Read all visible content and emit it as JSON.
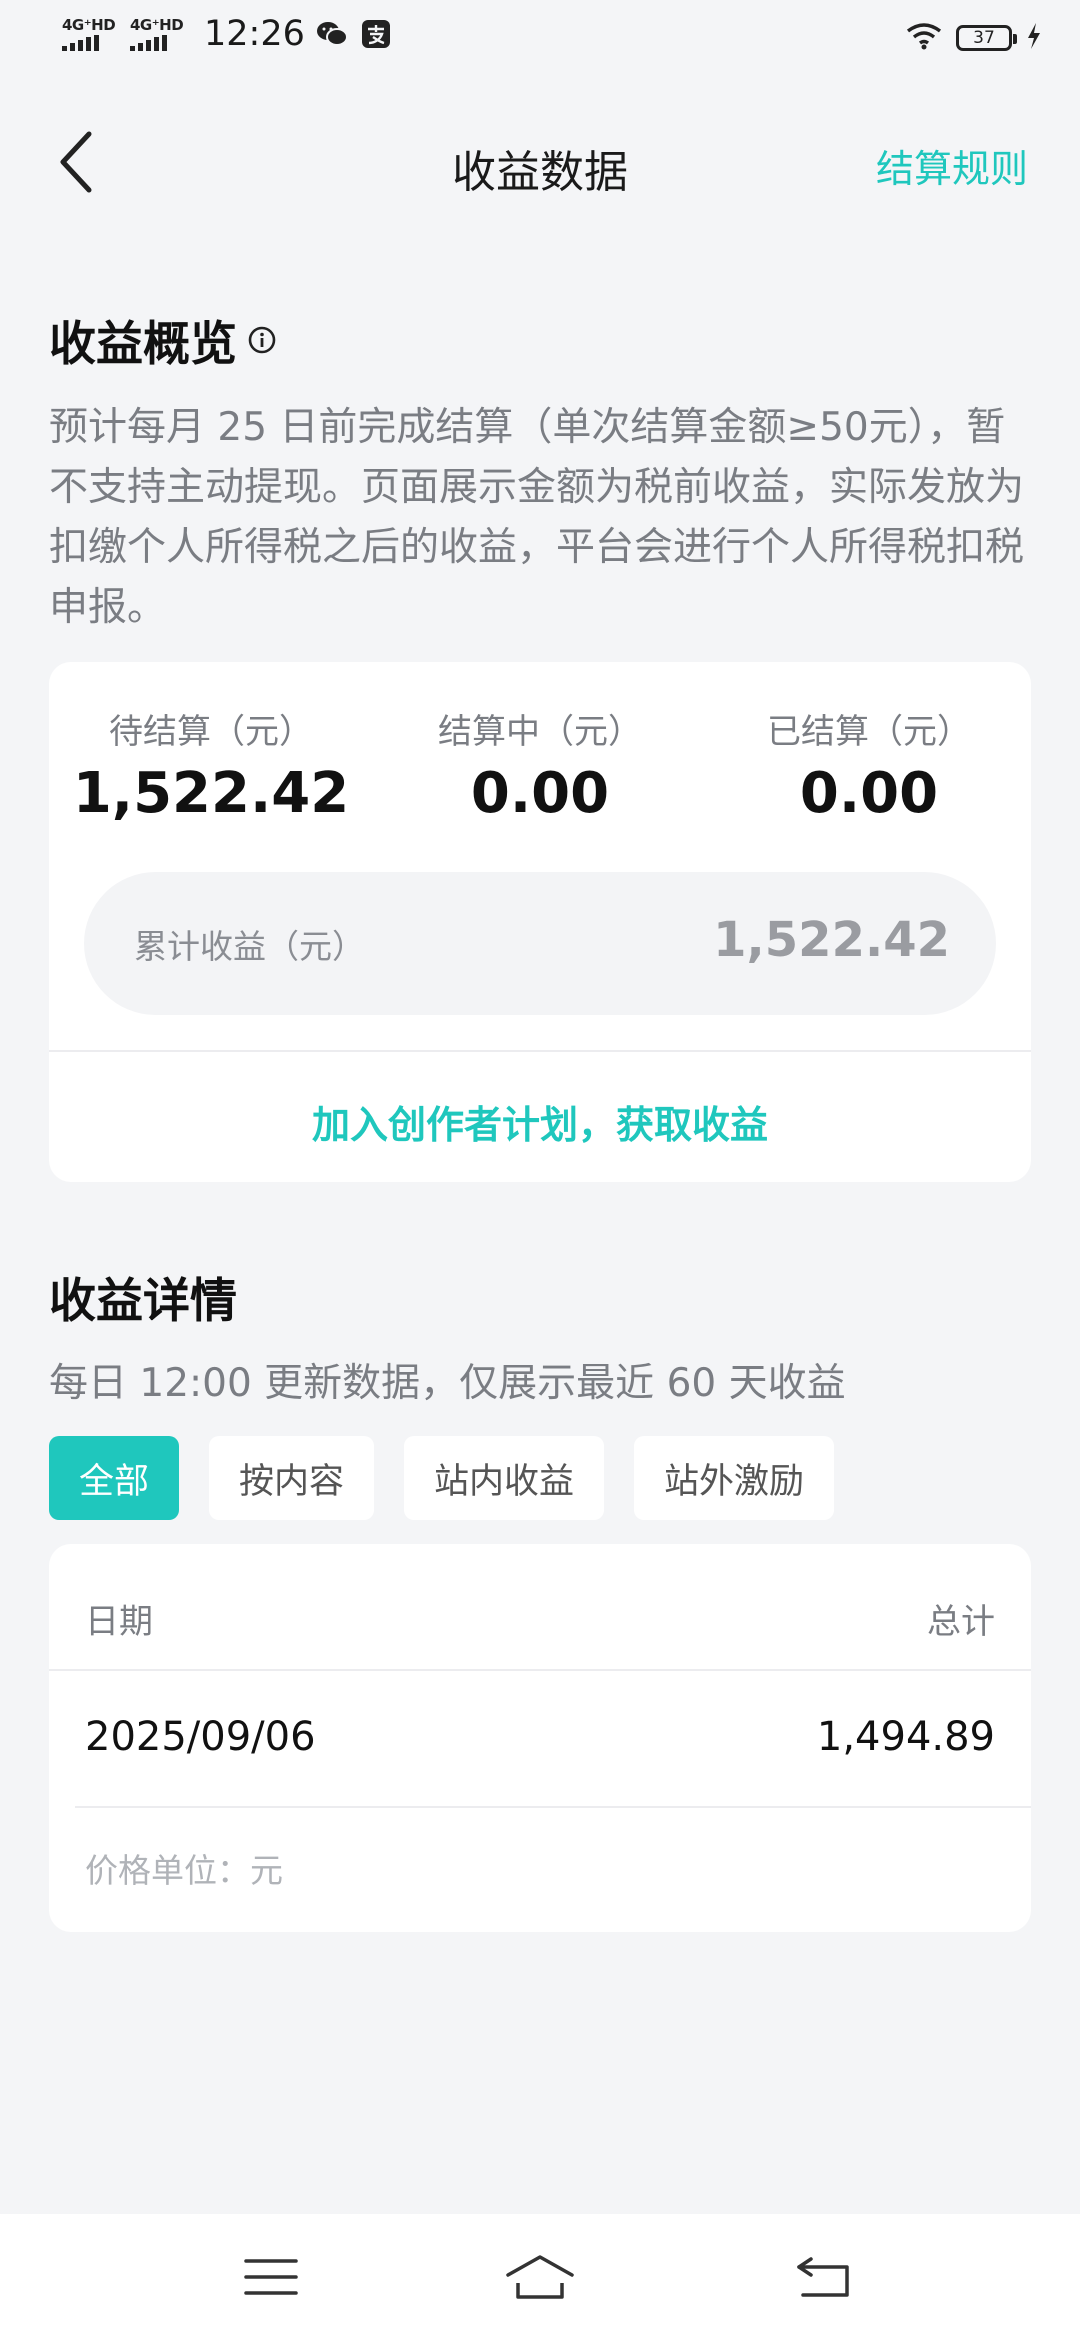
{
  "status_bar": {
    "signal1_label": "4G⁺HD",
    "signal2_label": "4G⁺HD",
    "time": "12:26",
    "battery": "37",
    "icons": [
      "wechat-icon",
      "alipay-icon",
      "wifi-icon",
      "battery-icon",
      "charging-icon"
    ]
  },
  "header": {
    "title": "收益数据",
    "rules_link": "结算规则"
  },
  "overview": {
    "title": "收益概览",
    "description": "预计每月 25 日前完成结算（单次结算金额≥50元），暂不支持主动提现。页面展示金额为税前收益，实际发放为扣缴个人所得税之后的收益，平台会进行个人所得税扣税申报。",
    "stats": [
      {
        "label": "待结算（元）",
        "value": "1,522.42"
      },
      {
        "label": "结算中（元）",
        "value": "0.00"
      },
      {
        "label": "已结算（元）",
        "value": "0.00"
      }
    ],
    "total_label": "累计收益（元）",
    "total_value": "1,522.42",
    "join_link": "加入创作者计划，获取收益"
  },
  "details": {
    "title": "收益详情",
    "description": "每日 12:00 更新数据，仅展示最近 60 天收益",
    "filters": [
      "全部",
      "按内容",
      "站内收益",
      "站外激励"
    ],
    "active_filter": "全部",
    "table": {
      "headers": {
        "date": "日期",
        "total": "总计"
      },
      "rows": [
        {
          "date": "2025/09/06",
          "total": "1,494.89"
        }
      ],
      "unit_note": "价格单位：元"
    }
  },
  "colors": {
    "accent": "#1fc7bd",
    "background": "#f4f5f7",
    "card": "#ffffff",
    "muted_text": "#7a7d83"
  }
}
